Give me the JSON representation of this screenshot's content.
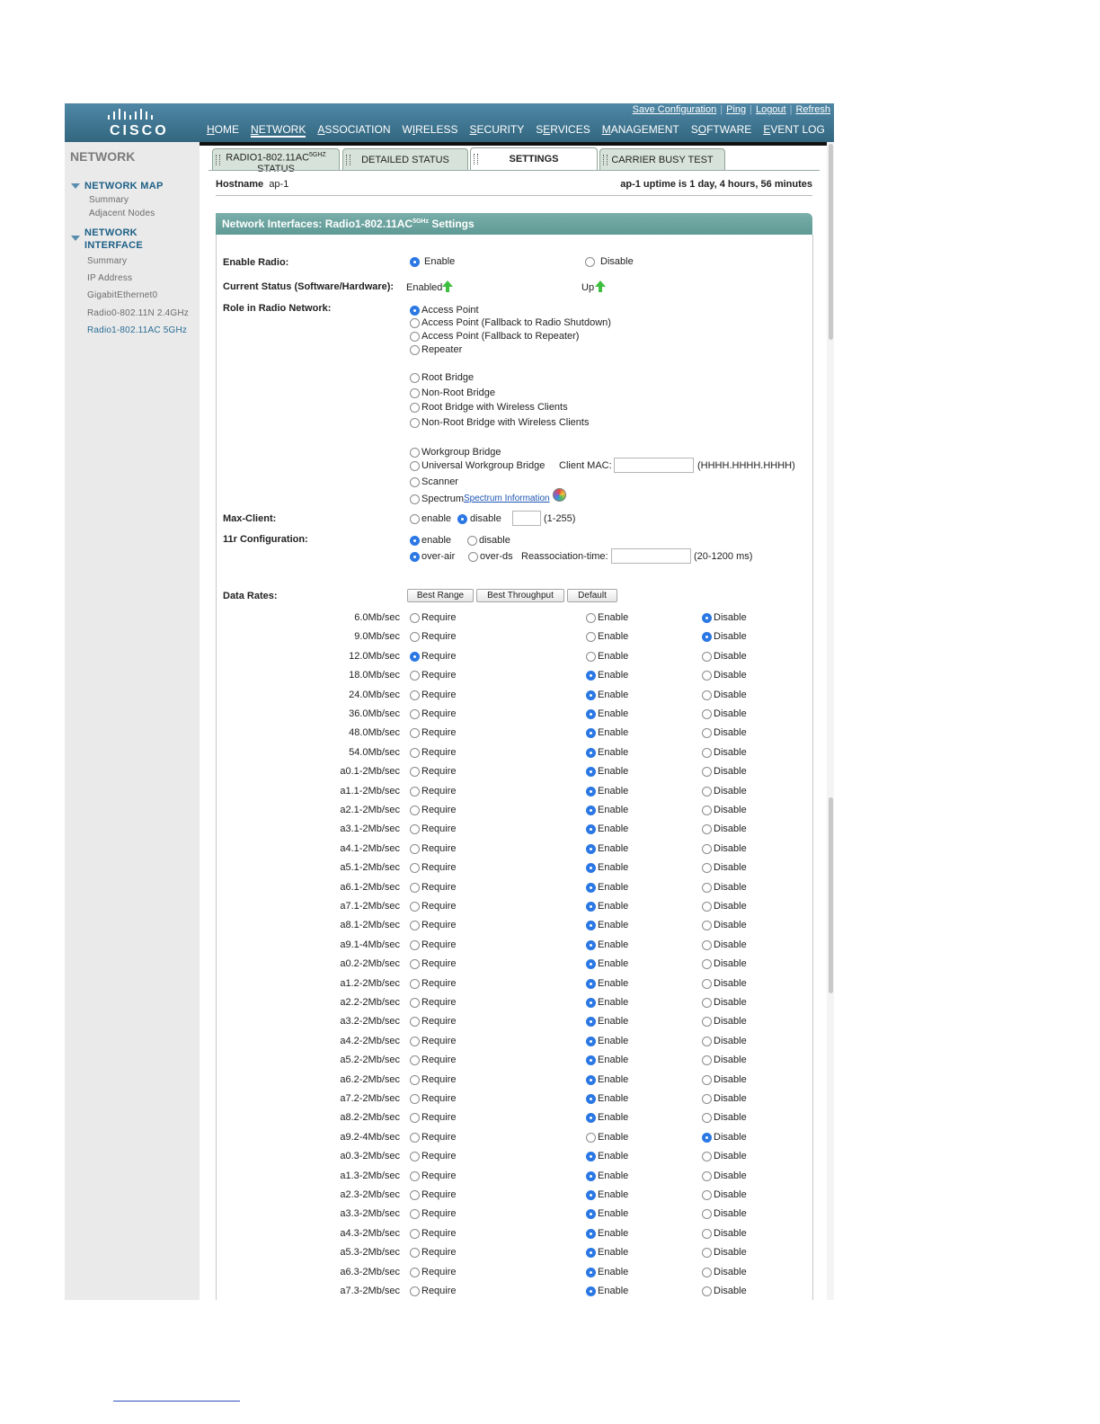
{
  "brand": {
    "logo_text": "CISCO"
  },
  "utility_links": [
    "Save Configuration",
    "Ping",
    "Logout",
    "Refresh"
  ],
  "nav": {
    "items": [
      {
        "ul": "H",
        "rest": "OME"
      },
      {
        "ul": "N",
        "rest": "ETWORK"
      },
      {
        "ul": "A",
        "rest": "SSOCIATION"
      },
      {
        "pre": "W",
        "ul": "I",
        "rest": "RELESS"
      },
      {
        "ul": "S",
        "rest": "ECURITY"
      },
      {
        "pre": "S",
        "ul": "E",
        "rest": "RVICES"
      },
      {
        "ul": "M",
        "rest": "ANAGEMENT"
      },
      {
        "pre": "S",
        "ul": "O",
        "rest": "FTWARE"
      },
      {
        "ul": "E",
        "rest": "VENT LOG"
      }
    ],
    "active_index": 1
  },
  "sidebar": {
    "title": "NETWORK",
    "section1": "NETWORK MAP",
    "section1_items": [
      "Summary",
      "Adjacent Nodes"
    ],
    "section2_line1": "NETWORK",
    "section2_line2": "INTERFACE",
    "section2_items": [
      "Summary",
      "IP Address",
      "GigabitEthernet0",
      "Radio0-802.11N 2.4GHz",
      "Radio1-802.11AC 5GHz"
    ],
    "active_item": "Radio1-802.11AC 5GHz"
  },
  "tabs": {
    "status_line1": "RADIO1-802.11AC",
    "status_sup": "5GHZ",
    "status_line2": "STATUS",
    "detailed": "DETAILED STATUS",
    "settings": "SETTINGS",
    "carrier": "CARRIER BUSY TEST",
    "active": "SETTINGS"
  },
  "host": {
    "label": "Hostname",
    "name": "ap-1",
    "uptime": "ap-1 uptime is 1 day, 4 hours, 56 minutes"
  },
  "panel": {
    "title_pre": "Network Interfaces: Radio1-802.11AC",
    "title_sup": "5GHz",
    "title_post": " Settings"
  },
  "enable_radio": {
    "label": "Enable Radio:",
    "opt1": "Enable",
    "opt2": "Disable",
    "selected": "Enable"
  },
  "current_status": {
    "label": "Current Status (Software/Hardware):",
    "software": "Enabled",
    "hardware": "Up"
  },
  "role": {
    "label": "Role in Radio Network:",
    "options": [
      "Access Point",
      "Access Point (Fallback to Radio Shutdown)",
      "Access Point (Fallback to Repeater)",
      "Repeater",
      "Root Bridge",
      "Non-Root Bridge",
      "Root Bridge with Wireless Clients",
      "Non-Root Bridge with Wireless Clients",
      "Workgroup Bridge",
      "Universal Workgroup Bridge",
      "Scanner",
      "Spectrum"
    ],
    "selected": "Access Point",
    "client_mac_label": "Client MAC:",
    "client_mac_value": "",
    "client_mac_format": "(HHHH.HHHH.HHHH)",
    "spectrum_link": "Spectrum Information"
  },
  "max_client": {
    "label": "Max-Client:",
    "opt1": "enable",
    "opt2": "disable",
    "selected": "disable",
    "value": "",
    "range": "(1-255)"
  },
  "r11_config": {
    "label": "11r Configuration:",
    "opt1": "enable",
    "opt2": "disable",
    "selected1": "enable",
    "opt3": "over-air",
    "opt4": "over-ds",
    "selected2": "over-air",
    "reassoc_label": "Reassociation-time:",
    "reassoc_value": "",
    "reassoc_range": "(20-1200 ms)"
  },
  "data_rates": {
    "label": "Data Rates:",
    "buttons": [
      "Best Range",
      "Best Throughput",
      "Default"
    ],
    "col_labels": [
      "Require",
      "Enable",
      "Disable"
    ],
    "rows": [
      {
        "rate": "6.0Mb/sec",
        "sel": "Disable"
      },
      {
        "rate": "9.0Mb/sec",
        "sel": "Disable"
      },
      {
        "rate": "12.0Mb/sec",
        "sel": "Require"
      },
      {
        "rate": "18.0Mb/sec",
        "sel": "Enable"
      },
      {
        "rate": "24.0Mb/sec",
        "sel": "Enable"
      },
      {
        "rate": "36.0Mb/sec",
        "sel": "Enable"
      },
      {
        "rate": "48.0Mb/sec",
        "sel": "Enable"
      },
      {
        "rate": "54.0Mb/sec",
        "sel": "Enable"
      },
      {
        "rate": "a0.1-2Mb/sec",
        "sel": "Enable"
      },
      {
        "rate": "a1.1-2Mb/sec",
        "sel": "Enable"
      },
      {
        "rate": "a2.1-2Mb/sec",
        "sel": "Enable"
      },
      {
        "rate": "a3.1-2Mb/sec",
        "sel": "Enable"
      },
      {
        "rate": "a4.1-2Mb/sec",
        "sel": "Enable"
      },
      {
        "rate": "a5.1-2Mb/sec",
        "sel": "Enable"
      },
      {
        "rate": "a6.1-2Mb/sec",
        "sel": "Enable"
      },
      {
        "rate": "a7.1-2Mb/sec",
        "sel": "Enable"
      },
      {
        "rate": "a8.1-2Mb/sec",
        "sel": "Enable"
      },
      {
        "rate": "a9.1-4Mb/sec",
        "sel": "Enable"
      },
      {
        "rate": "a0.2-2Mb/sec",
        "sel": "Enable"
      },
      {
        "rate": "a1.2-2Mb/sec",
        "sel": "Enable"
      },
      {
        "rate": "a2.2-2Mb/sec",
        "sel": "Enable"
      },
      {
        "rate": "a3.2-2Mb/sec",
        "sel": "Enable"
      },
      {
        "rate": "a4.2-2Mb/sec",
        "sel": "Enable"
      },
      {
        "rate": "a5.2-2Mb/sec",
        "sel": "Enable"
      },
      {
        "rate": "a6.2-2Mb/sec",
        "sel": "Enable"
      },
      {
        "rate": "a7.2-2Mb/sec",
        "sel": "Enable"
      },
      {
        "rate": "a8.2-2Mb/sec",
        "sel": "Enable"
      },
      {
        "rate": "a9.2-4Mb/sec",
        "sel": "Disable"
      },
      {
        "rate": "a0.3-2Mb/sec",
        "sel": "Enable"
      },
      {
        "rate": "a1.3-2Mb/sec",
        "sel": "Enable"
      },
      {
        "rate": "a2.3-2Mb/sec",
        "sel": "Enable"
      },
      {
        "rate": "a3.3-2Mb/sec",
        "sel": "Enable"
      },
      {
        "rate": "a4.3-2Mb/sec",
        "sel": "Enable"
      },
      {
        "rate": "a5.3-2Mb/sec",
        "sel": "Enable"
      },
      {
        "rate": "a6.3-2Mb/sec",
        "sel": "Enable"
      },
      {
        "rate": "a7.3-2Mb/sec",
        "sel": "Enable"
      }
    ]
  },
  "icons": {
    "status_arrow": "green-up-arrow-icon",
    "spectrum": "spectrum-color-wheel-icon",
    "tree_toggle": "triangle-down-icon"
  },
  "colors": {
    "banner": "#3f7893",
    "accent_radio": "#2b78e4",
    "panel_header": "#6ea5a0",
    "sidebar_link": "#1d5f86"
  }
}
